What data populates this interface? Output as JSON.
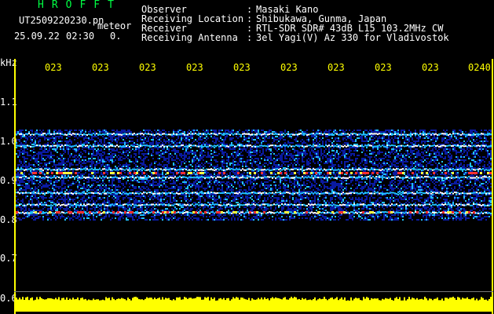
{
  "header": {
    "brand": "HROFFT",
    "file_name": "UT2509220230.pn",
    "meteor_label": "meteor",
    "date": "25.09.22",
    "time": "02:30",
    "meteor_count": "0.",
    "observer_label": "Observer",
    "observer_value": "Masaki Kano",
    "location_label": "Receiving Location",
    "location_value": "Shibukawa, Gunma, Japan",
    "receiver_label": "Receiver",
    "receiver_value": "RTL-SDR SDR# 43dB L15 103.2MHz CW",
    "antenna_label": "Receiving Antenna",
    "antenna_value": "3el Yagi(V) Az 330 for Vladivostok",
    "colon": ":"
  },
  "axis": {
    "unit": "kHz",
    "y_ticks": [
      "1.1",
      "1.0",
      "0.9",
      "0.8",
      "0.7",
      "0.6"
    ],
    "x_ticks": [
      "023",
      "023",
      "023",
      "023",
      "023",
      "023",
      "023",
      "023",
      "023",
      "0240"
    ]
  },
  "spectrogram": {
    "freq_range_khz": [
      0.6,
      1.15
    ],
    "signal_bands_khz": [
      1.02,
      0.99,
      0.93,
      0.91,
      0.87,
      0.84,
      0.82
    ],
    "strong_bands_khz": [
      0.92,
      0.82
    ],
    "noise_floor_khz": [
      0.8,
      1.03
    ],
    "colors": {
      "background": "#000000",
      "low": "#0a1aa0",
      "mid": "#20c0ff",
      "high": "#ff3030",
      "axis": "#ffff00",
      "amplitude": "#ffff00"
    }
  }
}
